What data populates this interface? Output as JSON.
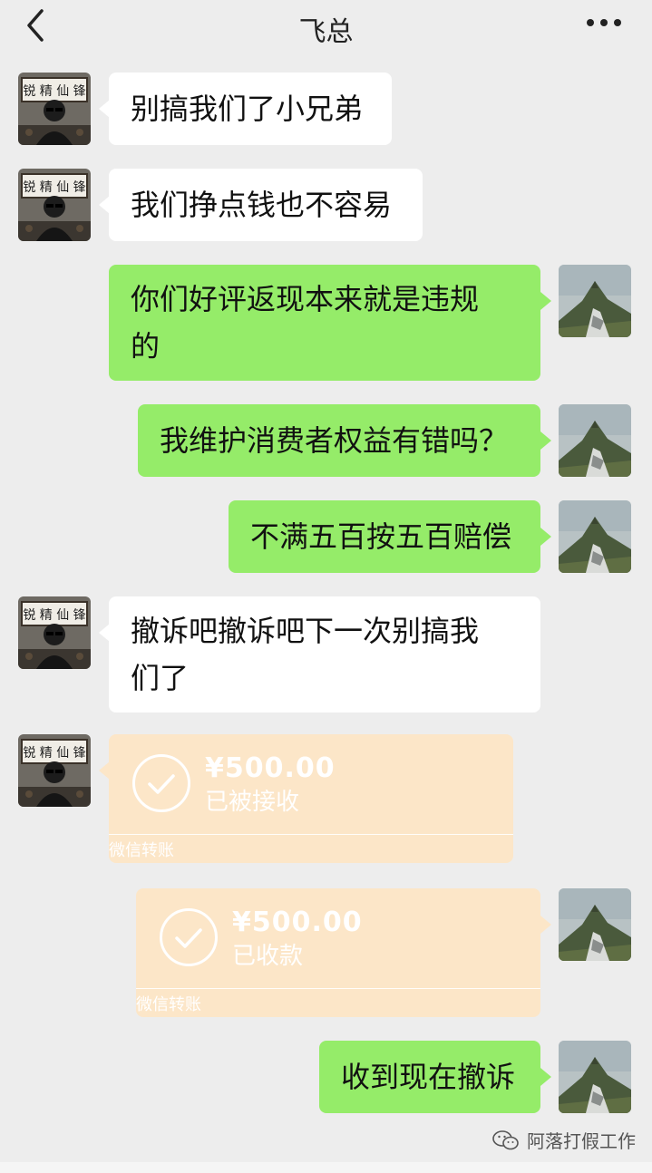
{
  "header": {
    "title": "飞总",
    "back_icon": "chevron-left-icon",
    "more_icon": "more-dots-icon"
  },
  "messages": [
    {
      "side": "left",
      "text": "别搞我们了小兄弟"
    },
    {
      "side": "left",
      "text": "我们挣点钱也不容易"
    },
    {
      "side": "right",
      "text_line1": "你们好评返现本来就是违规",
      "text_line2": "的"
    },
    {
      "side": "right",
      "text": "我维护消费者权益有错吗？"
    },
    {
      "side": "right",
      "text": "不满五百按五百赔偿"
    },
    {
      "side": "left",
      "text_line1": "撤诉吧撤诉吧下一次别搞我",
      "text_line2": "们了"
    },
    {
      "side": "right",
      "text": "收到现在撤诉"
    }
  ],
  "transfers": [
    {
      "side": "left",
      "amount": "¥500.00",
      "status": "已被接收",
      "footer": "微信转账"
    },
    {
      "side": "right",
      "amount": "¥500.00",
      "status": "已收款",
      "footer": "微信转账"
    }
  ],
  "watermark": {
    "text": "阿落打假工作",
    "icon": "wechat-icon"
  },
  "colors": {
    "background": "#ededed",
    "bubble_left": "#ffffff",
    "bubble_right": "#95ec69",
    "transfer": "#fce6c8"
  }
}
